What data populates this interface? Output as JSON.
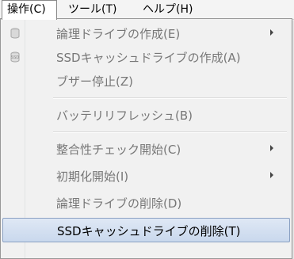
{
  "menubar": {
    "items": [
      {
        "label": "操作(C)"
      },
      {
        "label": "ツール(T)"
      },
      {
        "label": "ヘルプ(H)"
      }
    ]
  },
  "menu": {
    "items": [
      {
        "label": "論理ドライブの作成(E)",
        "icon": "disk-icon",
        "submenu": true,
        "enabled": false
      },
      {
        "label": "SSDキャッシュドライブの作成(A)",
        "icon": "ssd-icon",
        "submenu": false,
        "enabled": false
      },
      {
        "label": "ブザー停止(Z)",
        "submenu": false,
        "enabled": false
      },
      {
        "label": "バッテリリフレッシュ(B)",
        "submenu": false,
        "enabled": false
      },
      {
        "label": "整合性チェック開始(C)",
        "submenu": true,
        "enabled": false
      },
      {
        "label": "初期化開始(I)",
        "submenu": true,
        "enabled": false
      },
      {
        "label": "論理ドライブの削除(D)",
        "submenu": false,
        "enabled": false
      },
      {
        "label": "SSDキャッシュドライブの削除(T)",
        "submenu": false,
        "enabled": true,
        "highlighted": true
      }
    ]
  },
  "colors": {
    "highlight": "#c9d8ed",
    "disabled_text": "#777777"
  }
}
